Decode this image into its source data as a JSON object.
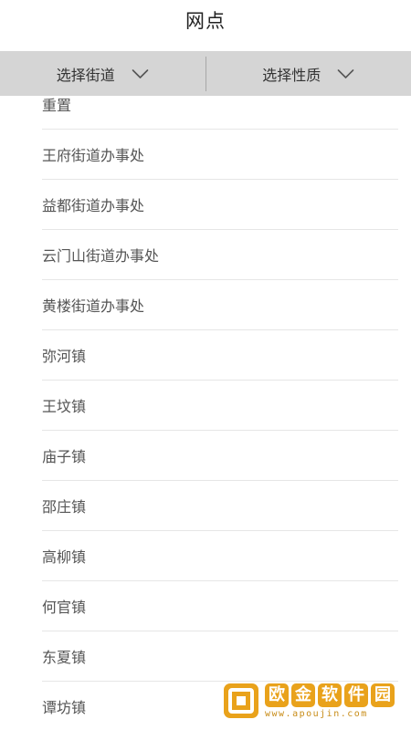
{
  "header": {
    "title": "网点"
  },
  "filters": {
    "street": {
      "label": "选择街道",
      "icon": "chevron-down-icon"
    },
    "nature": {
      "label": "选择性质",
      "icon": "chevron-down-icon"
    }
  },
  "list": {
    "items": [
      "重置",
      "王府街道办事处",
      "益都街道办事处",
      "云门山街道办事处",
      "黄楼街道办事处",
      "弥河镇",
      "王坟镇",
      "庙子镇",
      "邵庄镇",
      "高柳镇",
      "何官镇",
      "东夏镇",
      "谭坊镇"
    ]
  },
  "watermark": {
    "chars": [
      "欧",
      "金",
      "软",
      "件",
      "园"
    ],
    "url": "www.apoujin.com"
  },
  "colors": {
    "filter_bar_bg": "#d5d5d5",
    "watermark_accent": "#e9a21b"
  }
}
